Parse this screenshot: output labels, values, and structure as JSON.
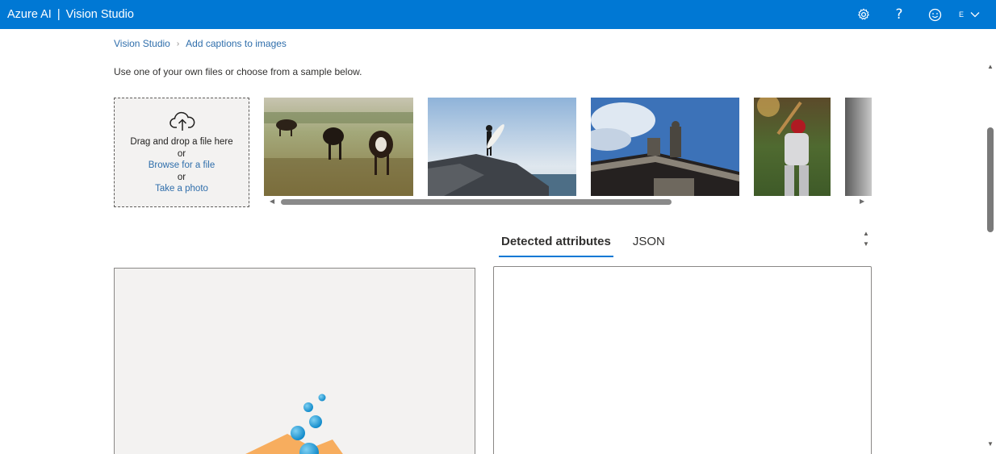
{
  "header": {
    "brand_left": "Azure AI",
    "brand_sep": "|",
    "brand_right": "Vision Studio",
    "account_initial": "E",
    "icons": [
      "gear-icon",
      "help-icon",
      "feedback-smiley-icon",
      "chevron-down-icon"
    ],
    "help_glyph": "?",
    "color": "#0078d4"
  },
  "breadcrumb": {
    "root": "Vision Studio",
    "current": "Add captions to images"
  },
  "intro": "Use one of your own files or choose from a sample below.",
  "upload": {
    "line1": "Drag and drop a file here",
    "or1": "or",
    "browse": "Browse for a file",
    "or2": "or",
    "photo": "Take a photo"
  },
  "gallery": {
    "samples": [
      "cows-grazing-image",
      "surfer-on-rock-image",
      "building-statues-image",
      "baseball-batter-image",
      "partial-gray-image"
    ]
  },
  "tabs": {
    "detected": "Detected attributes",
    "json": "JSON",
    "active": "Detected attributes"
  }
}
